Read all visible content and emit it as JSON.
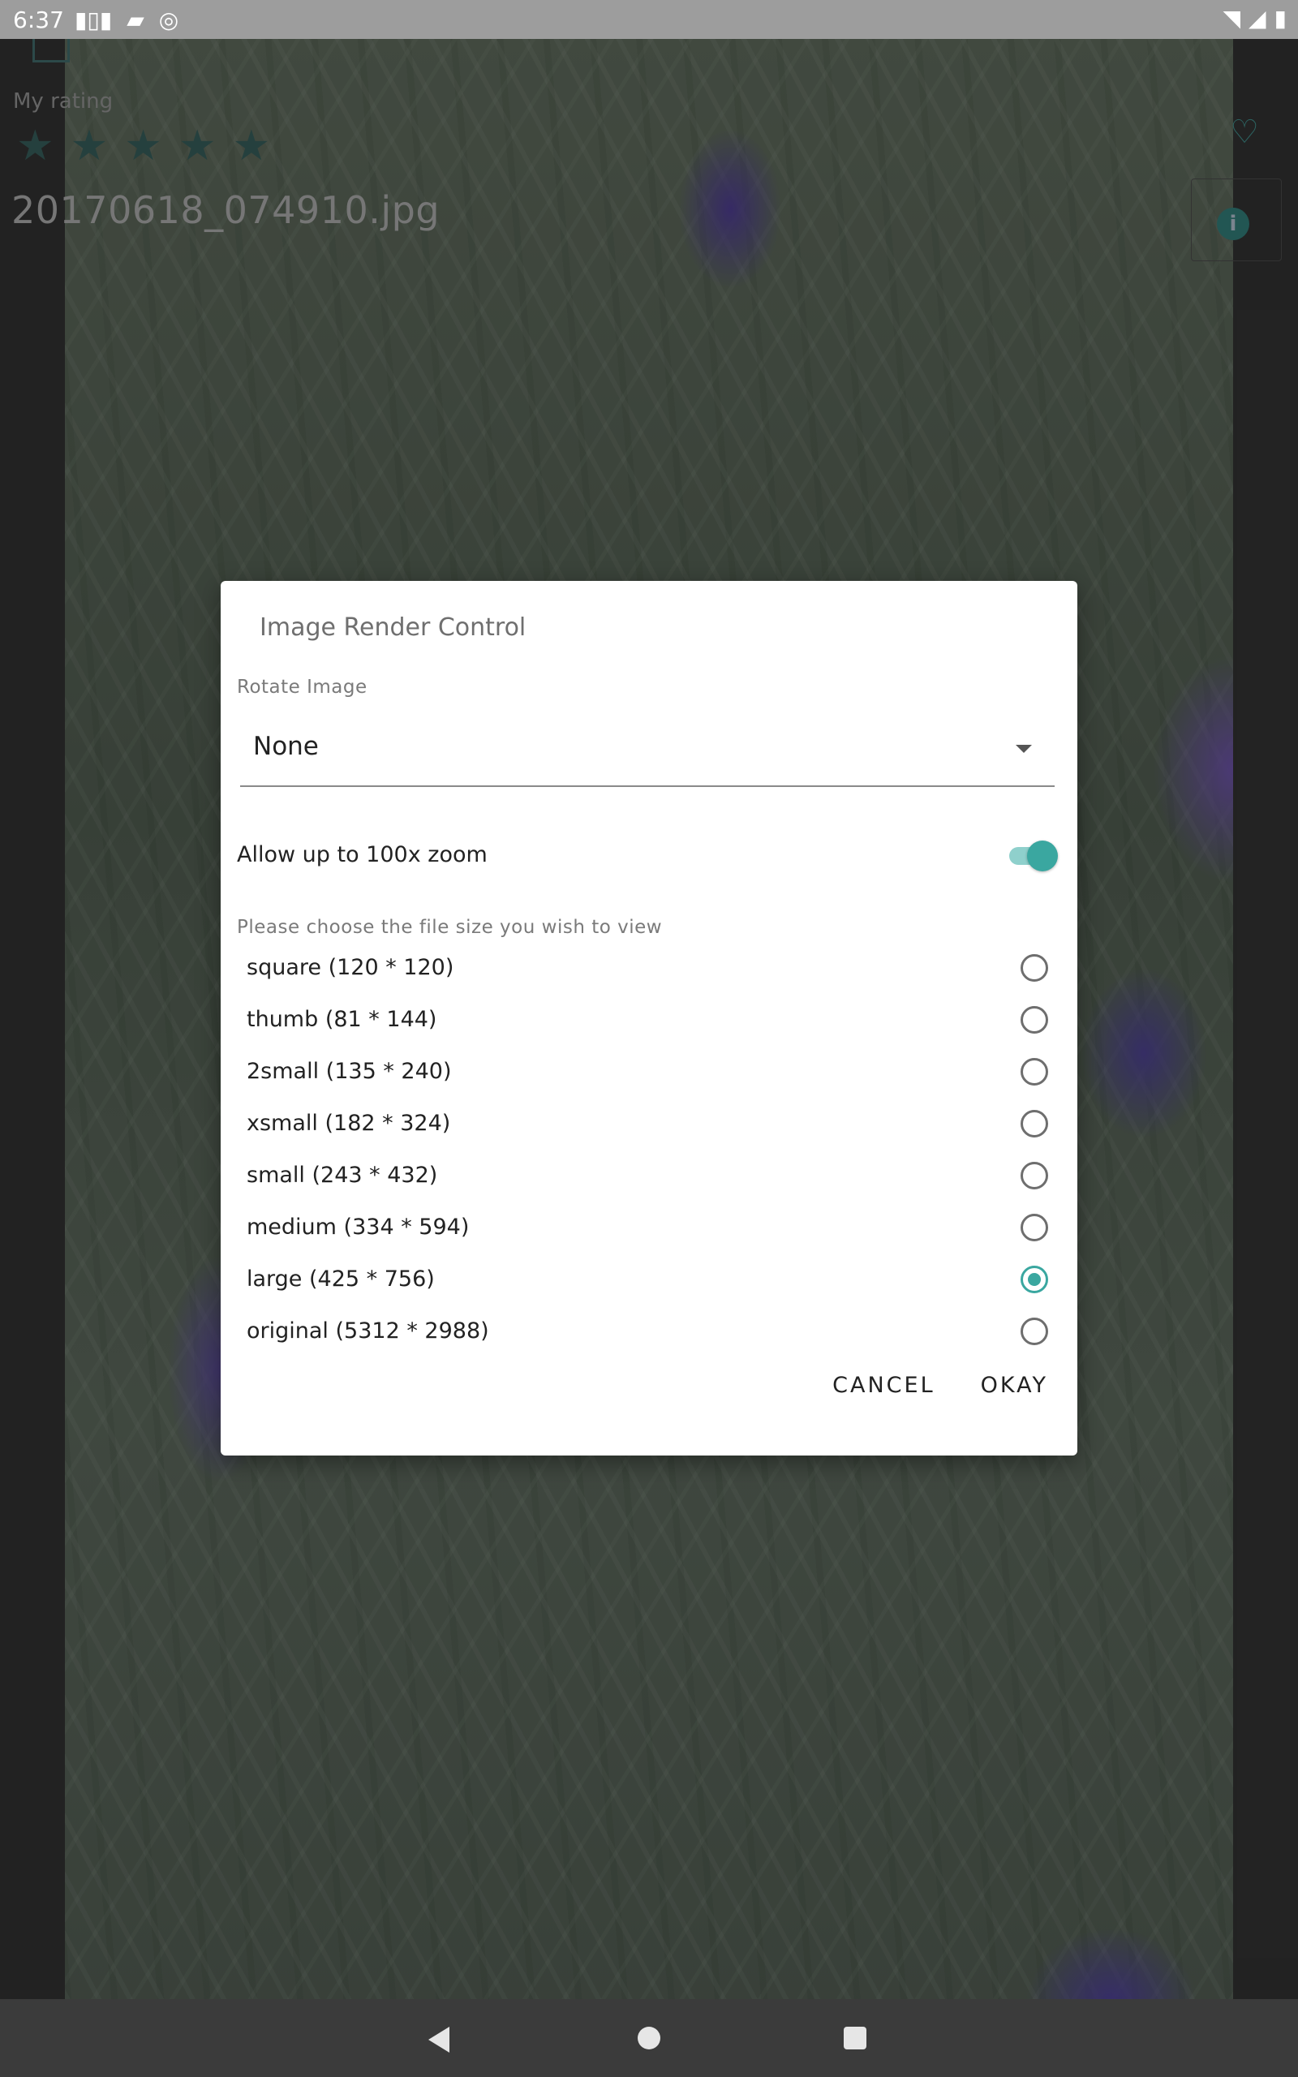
{
  "status_bar": {
    "time": "6:37",
    "left_icons": [
      "signal-bars-icon",
      "sd-card-icon",
      "circle-status-icon"
    ],
    "right_icons": [
      "wifi-icon",
      "cell-signal-icon",
      "battery-icon"
    ]
  },
  "background": {
    "my_rating_label": "My rating",
    "stars": [
      "★",
      "★",
      "★",
      "★",
      "★"
    ],
    "filename": "20170618_074910.jpg",
    "heart_glyph": "♡",
    "info_glyph": "i"
  },
  "dialog": {
    "title": "Image Render Control",
    "rotate_label": "Rotate Image",
    "rotate_value": "None",
    "zoom_label": "Allow up to 100x zoom",
    "zoom_enabled": true,
    "size_label": "Please choose the file size you wish to view",
    "options": [
      {
        "label": "square (120 * 120)",
        "checked": false
      },
      {
        "label": "thumb (81 * 144)",
        "checked": false
      },
      {
        "label": "2small (135 * 240)",
        "checked": false
      },
      {
        "label": "xsmall (182 * 324)",
        "checked": false
      },
      {
        "label": "small (243 * 432)",
        "checked": false
      },
      {
        "label": "medium (334 * 594)",
        "checked": false
      },
      {
        "label": "large (425 * 756)",
        "checked": true
      },
      {
        "label": "original (5312 * 2988)",
        "checked": false
      }
    ],
    "cancel_label": "CANCEL",
    "okay_label": "OKAY"
  },
  "colors": {
    "accent": "#3aa7a0",
    "status_bar": "#9d9d9d",
    "nav_bar": "#3b3b3b"
  }
}
